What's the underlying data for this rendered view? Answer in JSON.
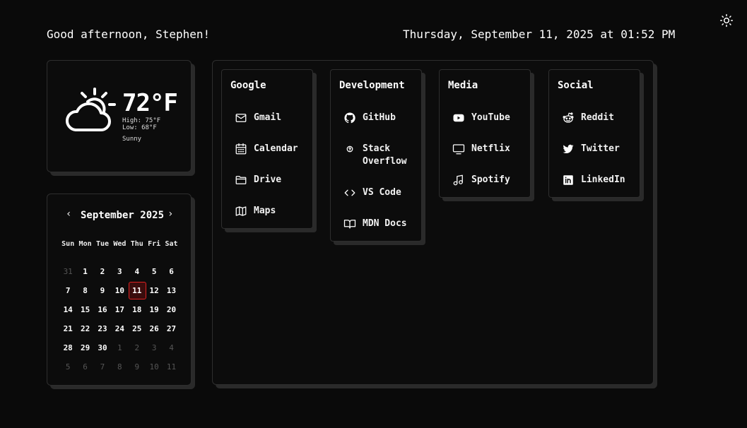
{
  "header": {
    "greeting": "Good afternoon, Stephen!",
    "datetime": "Thursday, September 11, 2025 at 01:52 PM",
    "theme_icon": "sun-icon"
  },
  "weather": {
    "icon": "partly-sunny-icon",
    "temperature": "72°F",
    "high": "High: 75°F",
    "low": "Low: 68°F",
    "condition": "Sunny"
  },
  "calendar": {
    "title": "September 2025",
    "prev": "‹",
    "next": "›",
    "weekdays": [
      "Sun",
      "Mon",
      "Tue",
      "Wed",
      "Thu",
      "Fri",
      "Sat"
    ],
    "weeks": [
      [
        {
          "d": "31",
          "m": true
        },
        {
          "d": "1"
        },
        {
          "d": "2"
        },
        {
          "d": "3"
        },
        {
          "d": "4"
        },
        {
          "d": "5"
        },
        {
          "d": "6"
        }
      ],
      [
        {
          "d": "7"
        },
        {
          "d": "8"
        },
        {
          "d": "9"
        },
        {
          "d": "10"
        },
        {
          "d": "11",
          "today": true
        },
        {
          "d": "12"
        },
        {
          "d": "13"
        }
      ],
      [
        {
          "d": "14"
        },
        {
          "d": "15"
        },
        {
          "d": "16"
        },
        {
          "d": "17"
        },
        {
          "d": "18"
        },
        {
          "d": "19"
        },
        {
          "d": "20"
        }
      ],
      [
        {
          "d": "21"
        },
        {
          "d": "22"
        },
        {
          "d": "23"
        },
        {
          "d": "24"
        },
        {
          "d": "25"
        },
        {
          "d": "26"
        },
        {
          "d": "27"
        }
      ],
      [
        {
          "d": "28"
        },
        {
          "d": "29"
        },
        {
          "d": "30"
        },
        {
          "d": "1",
          "m": true
        },
        {
          "d": "2",
          "m": true
        },
        {
          "d": "3",
          "m": true
        },
        {
          "d": "4",
          "m": true
        }
      ],
      [
        {
          "d": "5",
          "m": true
        },
        {
          "d": "6",
          "m": true
        },
        {
          "d": "7",
          "m": true
        },
        {
          "d": "8",
          "m": true
        },
        {
          "d": "9",
          "m": true
        },
        {
          "d": "10",
          "m": true
        },
        {
          "d": "11",
          "m": true
        }
      ]
    ]
  },
  "groups": [
    {
      "title": "Google",
      "links": [
        {
          "label": "Gmail",
          "icon": "mail-icon"
        },
        {
          "label": "Calendar",
          "icon": "calendar-icon"
        },
        {
          "label": "Drive",
          "icon": "folder-icon"
        },
        {
          "label": "Maps",
          "icon": "map-icon"
        }
      ]
    },
    {
      "title": "Development",
      "links": [
        {
          "label": "GitHub",
          "icon": "github-icon"
        },
        {
          "label": "Stack\nOverflow",
          "icon": "help-circle-icon"
        },
        {
          "label": "VS Code",
          "icon": "code-icon"
        },
        {
          "label": "MDN Docs",
          "icon": "book-icon"
        }
      ]
    },
    {
      "title": "Media",
      "links": [
        {
          "label": "YouTube",
          "icon": "youtube-icon"
        },
        {
          "label": "Netflix",
          "icon": "tv-icon"
        },
        {
          "label": "Spotify",
          "icon": "music-icon"
        }
      ]
    },
    {
      "title": "Social",
      "links": [
        {
          "label": "Reddit",
          "icon": "reddit-icon"
        },
        {
          "label": "Twitter",
          "icon": "twitter-icon"
        },
        {
          "label": "LinkedIn",
          "icon": "linkedin-icon"
        }
      ]
    }
  ]
}
